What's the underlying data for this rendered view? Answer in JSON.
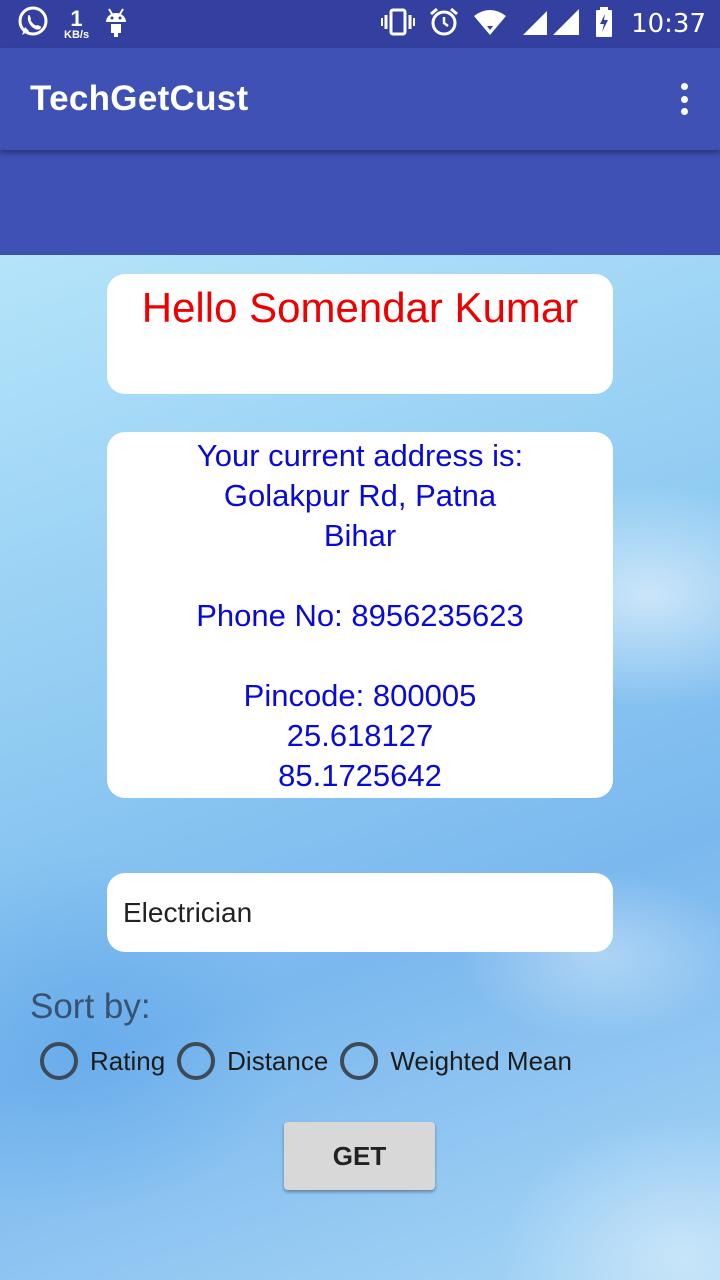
{
  "status_bar": {
    "netspeed_value": "1",
    "netspeed_unit": "KB/s",
    "time": "10:37",
    "icons": [
      "whatsapp-icon",
      "android-icon",
      "vibrate-icon",
      "alarm-icon",
      "wifi-icon",
      "signal-icon",
      "battery-charging-icon"
    ]
  },
  "app_bar": {
    "title": "TechGetCust",
    "menu_icon": "overflow-menu-icon"
  },
  "greeting": {
    "text": "Hello Somendar Kumar"
  },
  "address": {
    "heading": "Your current address is:",
    "line1": "Golakpur Rd, Patna",
    "line2": "Bihar",
    "phone": "Phone No: 8956235623",
    "pincode": "Pincode: 800005",
    "latitude": "25.618127",
    "longitude": "85.1725642"
  },
  "service_field": {
    "value": "Electrician"
  },
  "sort": {
    "label": "Sort by:",
    "options": [
      "Rating",
      "Distance",
      "Weighted Mean"
    ]
  },
  "get_button": {
    "label": "GET"
  },
  "colors": {
    "primary": "#3f51b5",
    "status_bar": "#3340a0",
    "greeting_text": "#ee0000",
    "address_text": "#0a0ad8"
  }
}
